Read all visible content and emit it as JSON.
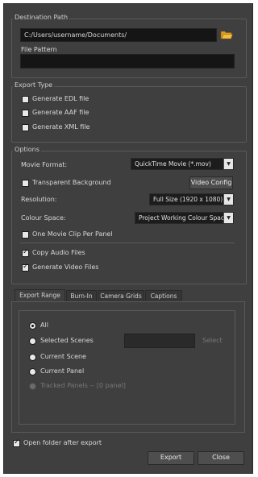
{
  "destination": {
    "title": "Destination Path",
    "path_value": "C:/Users/username/Documents/",
    "file_pattern_label": "File Pattern",
    "file_pattern_value": ""
  },
  "export_type": {
    "title": "Export Type",
    "items": [
      {
        "label": "Generate EDL file",
        "checked": false
      },
      {
        "label": "Generate AAF file",
        "checked": false
      },
      {
        "label": "Generate XML file",
        "checked": false
      }
    ]
  },
  "options": {
    "title": "Options",
    "movie_format_label": "Movie Format:",
    "movie_format_value": "QuickTime Movie (*.mov)",
    "transparent_bg_label": "Transparent Background",
    "transparent_bg_checked": false,
    "video_config_label": "Video Config",
    "resolution_label": "Resolution:",
    "resolution_value": "Full Size (1920 x 1080)",
    "colour_space_label": "Colour Space:",
    "colour_space_value": "Project Working Colour Space",
    "one_clip_label": "One Movie Clip Per Panel",
    "one_clip_checked": false,
    "copy_audio_label": "Copy Audio Files",
    "copy_audio_checked": true,
    "generate_video_label": "Generate Video Files",
    "generate_video_checked": true
  },
  "tabs": [
    {
      "label": "Export Range",
      "active": true
    },
    {
      "label": "Burn-In",
      "active": false
    },
    {
      "label": "Camera Grids",
      "active": false
    },
    {
      "label": "Captions",
      "active": false
    }
  ],
  "export_range": {
    "all_label": "All",
    "selected_scenes_label": "Selected Scenes",
    "select_button_label": "Select",
    "current_scene_label": "Current Scene",
    "current_panel_label": "Current Panel",
    "tracked_panels_label": "Tracked Panels -- [0 panel]",
    "selected": "All"
  },
  "footer": {
    "open_folder_label": "Open folder after export",
    "open_folder_checked": true,
    "export_label": "Export",
    "close_label": "Close"
  }
}
